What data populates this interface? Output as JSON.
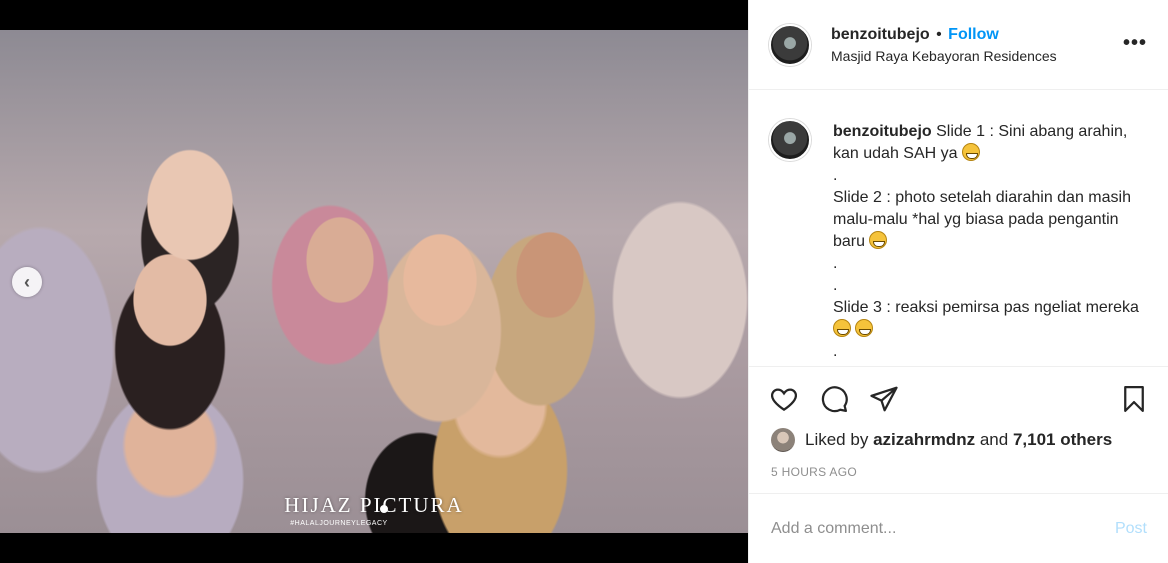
{
  "post": {
    "watermark": "HIJAZ PICTURA",
    "watermark_sub": "#HALALJOURNEYLEGACY",
    "prev_arrow": "‹"
  },
  "header": {
    "username": "benzoitubejo",
    "separator": "•",
    "follow_label": "Follow",
    "location": "Masjid Raya Kebayoran Residences",
    "more": "•••"
  },
  "caption": {
    "username": "benzoitubejo",
    "lines": [
      "Slide 1 : Sini abang arahin, kan udah SAH ya",
      ".",
      "Slide 2 : photo setelah diarahin dan masih malu-malu *hal yg biasa pada pengantin baru",
      ".",
      ".",
      "Slide 3 : reaksi pemirsa pas ngeliat mereka",
      "."
    ]
  },
  "actions": {
    "like_icon": "heart-icon",
    "comment_icon": "comment-icon",
    "share_icon": "share-icon",
    "save_icon": "bookmark-icon"
  },
  "likes": {
    "prefix": "Liked by",
    "user": "azizahrmdnz",
    "middle": "and",
    "count": "7,101 others"
  },
  "timestamp": "5 HOURS AGO",
  "comment_box": {
    "placeholder": "Add a comment...",
    "post_label": "Post"
  },
  "colors": {
    "link_blue": "#0095f6",
    "post_disabled": "#b2dffc",
    "muted": "#8e8e8e"
  }
}
